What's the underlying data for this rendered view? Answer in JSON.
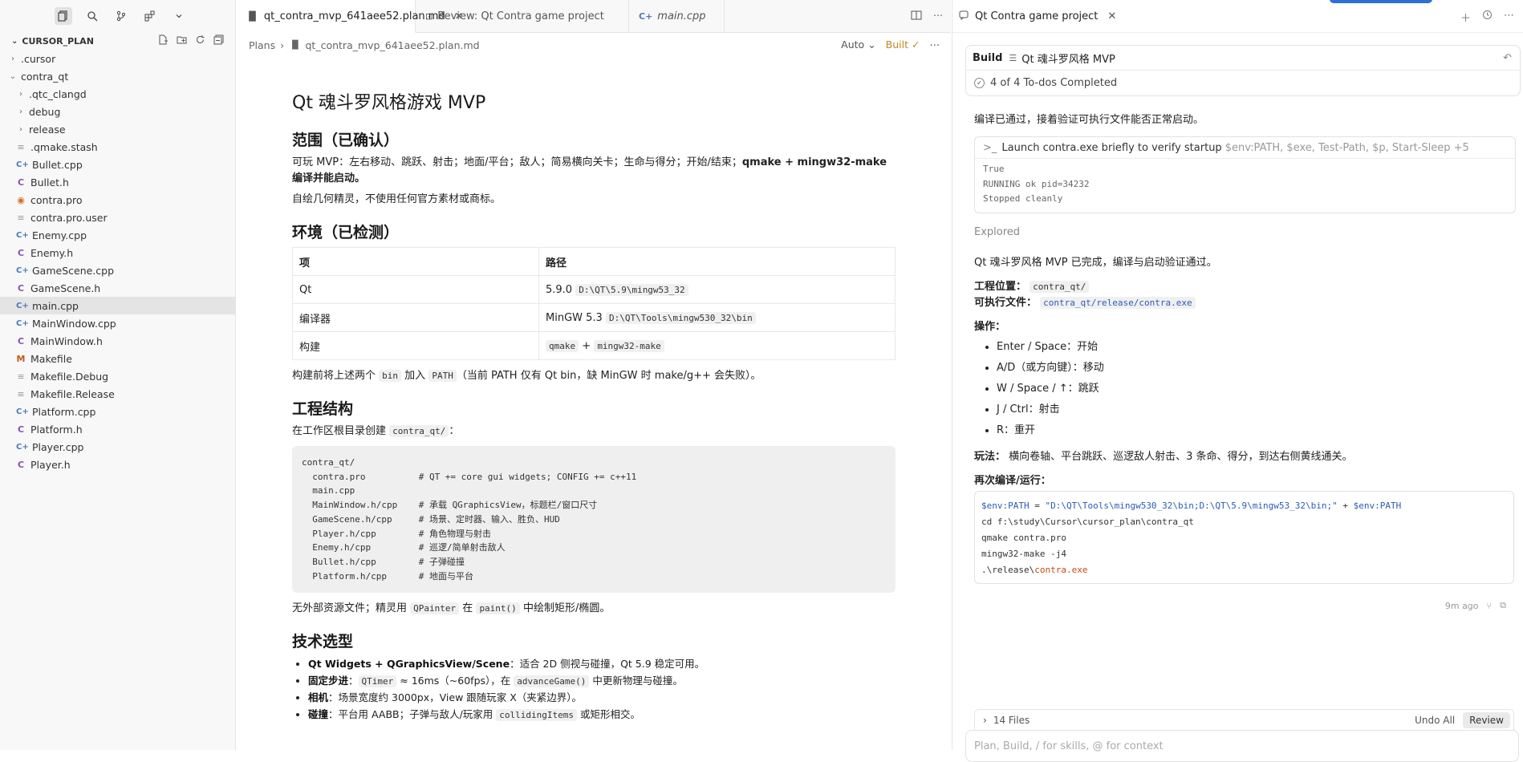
{
  "sidebar": {
    "tools": [
      "explorer-icon",
      "search-icon",
      "source-control-icon",
      "extensions-icon",
      "chevron-down-icon"
    ],
    "root_label": "CURSOR_PLAN",
    "tree": [
      {
        "label": ".cursor",
        "depth": 1,
        "kind": "folder",
        "expanded": false
      },
      {
        "label": "contra_qt",
        "depth": 1,
        "kind": "folder",
        "expanded": true
      },
      {
        "label": ".qtc_clangd",
        "depth": 2,
        "kind": "folder",
        "expanded": false
      },
      {
        "label": "debug",
        "depth": 2,
        "kind": "folder",
        "expanded": false
      },
      {
        "label": "release",
        "depth": 2,
        "kind": "folder",
        "expanded": false
      },
      {
        "label": ".qmake.stash",
        "depth": 2,
        "kind": "txt"
      },
      {
        "label": "Bullet.cpp",
        "depth": 2,
        "kind": "cpp"
      },
      {
        "label": "Bullet.h",
        "depth": 2,
        "kind": "h"
      },
      {
        "label": "contra.pro",
        "depth": 2,
        "kind": "pro"
      },
      {
        "label": "contra.pro.user",
        "depth": 2,
        "kind": "txt"
      },
      {
        "label": "Enemy.cpp",
        "depth": 2,
        "kind": "cpp"
      },
      {
        "label": "Enemy.h",
        "depth": 2,
        "kind": "h"
      },
      {
        "label": "GameScene.cpp",
        "depth": 2,
        "kind": "cpp"
      },
      {
        "label": "GameScene.h",
        "depth": 2,
        "kind": "h"
      },
      {
        "label": "main.cpp",
        "depth": 2,
        "kind": "cpp",
        "selected": true
      },
      {
        "label": "MainWindow.cpp",
        "depth": 2,
        "kind": "cpp"
      },
      {
        "label": "MainWindow.h",
        "depth": 2,
        "kind": "h"
      },
      {
        "label": "Makefile",
        "depth": 2,
        "kind": "make"
      },
      {
        "label": "Makefile.Debug",
        "depth": 2,
        "kind": "txt"
      },
      {
        "label": "Makefile.Release",
        "depth": 2,
        "kind": "txt"
      },
      {
        "label": "Platform.cpp",
        "depth": 2,
        "kind": "cpp"
      },
      {
        "label": "Platform.h",
        "depth": 2,
        "kind": "h"
      },
      {
        "label": "Player.cpp",
        "depth": 2,
        "kind": "cpp"
      },
      {
        "label": "Player.h",
        "depth": 2,
        "kind": "h"
      }
    ]
  },
  "editor": {
    "tabs": [
      {
        "label": "qt_contra_mvp_641aee52.plan.md",
        "active": true
      },
      {
        "label": "Review: Qt Contra game project",
        "active": false
      },
      {
        "label": "main.cpp",
        "active": false
      }
    ],
    "breadcrumb": [
      "Plans",
      "qt_contra_mvp_641aee52.plan.md"
    ],
    "mode_label": "Auto",
    "built_label": "Built",
    "doc": {
      "title": "Qt 魂斗罗风格游戏 MVP",
      "h_scope": "范围（已确认）",
      "scope_p1_a": "可玩 MVP：左右移动、跳跃、射击；地面/平台；敌人；简易横向关卡；生命与得分；开始/结束；",
      "scope_p1_b": "qmake + mingw32-make 编译并能启动。",
      "scope_p2": "自绘几何精灵，不使用任何官方素材或商标。",
      "h_env": "环境（已检测）",
      "env_headers": [
        "项",
        "路径"
      ],
      "env_rows": [
        {
          "item": "Qt",
          "text": "5.9.0",
          "code": "D:\\QT\\5.9\\mingw53_32"
        },
        {
          "item": "编译器",
          "text": "MinGW 5.3",
          "code": "D:\\QT\\Tools\\mingw530_32\\bin"
        },
        {
          "item": "构建",
          "code1": "qmake",
          "plus": "+",
          "code2": "mingw32-make"
        }
      ],
      "env_note_a": "构建前将上述两个",
      "env_note_code1": "bin",
      "env_note_b": "加入",
      "env_note_code2": "PATH",
      "env_note_c": "（当前 PATH 仅有 Qt bin，缺 MinGW 时 make/g++ 会失败）。",
      "h_struct": "工程结构",
      "struct_intro_a": "在工作区根目录创建",
      "struct_intro_code": "contra_qt/",
      "struct_intro_b": "：",
      "struct_tree": "contra_qt/\n  contra.pro          # QT += core gui widgets; CONFIG += c++11\n  main.cpp\n  MainWindow.h/cpp    # 承载 QGraphicsView，标题栏/窗口尺寸\n  GameScene.h/cpp     # 场景、定时器、输入、胜负、HUD\n  Player.h/cpp        # 角色物理与射击\n  Enemy.h/cpp         # 巡逻/简单射击敌人\n  Bullet.h/cpp        # 子弹碰撞\n  Platform.h/cpp      # 地面与平台",
      "struct_note_a": "无外部资源文件；精灵用",
      "struct_note_code1": "QPainter",
      "struct_note_b": "在",
      "struct_note_code2": "paint()",
      "struct_note_c": "中绘制矩形/椭圆。",
      "h_tech": "技术选型",
      "tech": [
        {
          "bold": "Qt Widgets + QGraphicsView/Scene",
          "a": "：适合 2D 侧视与碰撞，Qt 5.9 稳定可用。"
        },
        {
          "bold": "固定步进",
          "a": "：",
          "code1": "QTimer",
          "b": " ≈ 16ms（~60fps），在 ",
          "code2": "advanceGame()",
          "c": " 中更新物理与碰撞。"
        },
        {
          "bold": "相机",
          "a": "：场景宽度约 3000px，View 跟随玩家 X（夹紧边界）。"
        },
        {
          "bold": "碰撞",
          "a": "：平台用 AABB；子弹与敌人/玩家用 ",
          "code1": "collidingItems",
          "b": " 或矩形相交。"
        }
      ]
    }
  },
  "chat": {
    "tab_title": "Qt Contra game project",
    "build_label": "Build",
    "plan_title": "Qt 魂斗罗风格 MVP",
    "todos": "4 of 4 To-dos Completed",
    "msg1": "编译已通过，接着验证可执行文件能否正常启动。",
    "term_cmd": "Launch contra.exe briefly to verify startup",
    "term_args": "$env:PATH, $exe, Test-Path, $p, Start-Sleep +5",
    "term_out": [
      "True",
      "RUNNING ok pid=34232",
      "Stopped cleanly"
    ],
    "explored": "Explored",
    "summary": "Qt 魂斗罗风格 MVP 已完成，编译与启动验证通过。",
    "loc_label": "工程位置：",
    "loc_value": "contra_qt/",
    "exe_label": "可执行文件：",
    "exe_value": "contra_qt/release/contra.exe",
    "ops_label": "操作：",
    "ops": [
      "Enter / Space：开始",
      "A/D（或方向键）：移动",
      "W / Space / ↑：跳跃",
      "J / Ctrl：射击",
      "R：重开"
    ],
    "play_label": "玩法：",
    "play_text": "横向卷轴、平台跳跃、巡逻敌人射击、3 条命、得分，到达右侧黄线通关。",
    "rebuild_label": "再次编译/运行：",
    "cmd": {
      "line1_var": "$env:PATH",
      "line1_eq": " = ",
      "line1_str": "\"D:\\QT\\Tools\\mingw530_32\\bin;D:\\QT\\5.9\\mingw53_32\\bin;\"",
      "line1_plus": " + ",
      "line1_var2": "$env:PATH",
      "line2": "cd f:\\study\\Cursor\\cursor_plan\\contra_qt",
      "line3": "qmake contra.pro",
      "line4": "mingw32-make -j4",
      "line5_a": ".\\release\\",
      "line5_exe": "contra.exe"
    },
    "time_ago": "9m ago",
    "files_count": "14 Files",
    "undo_all": "Undo All",
    "review": "Review",
    "input_placeholder": "Plan, Build, / for skills, @ for context"
  }
}
